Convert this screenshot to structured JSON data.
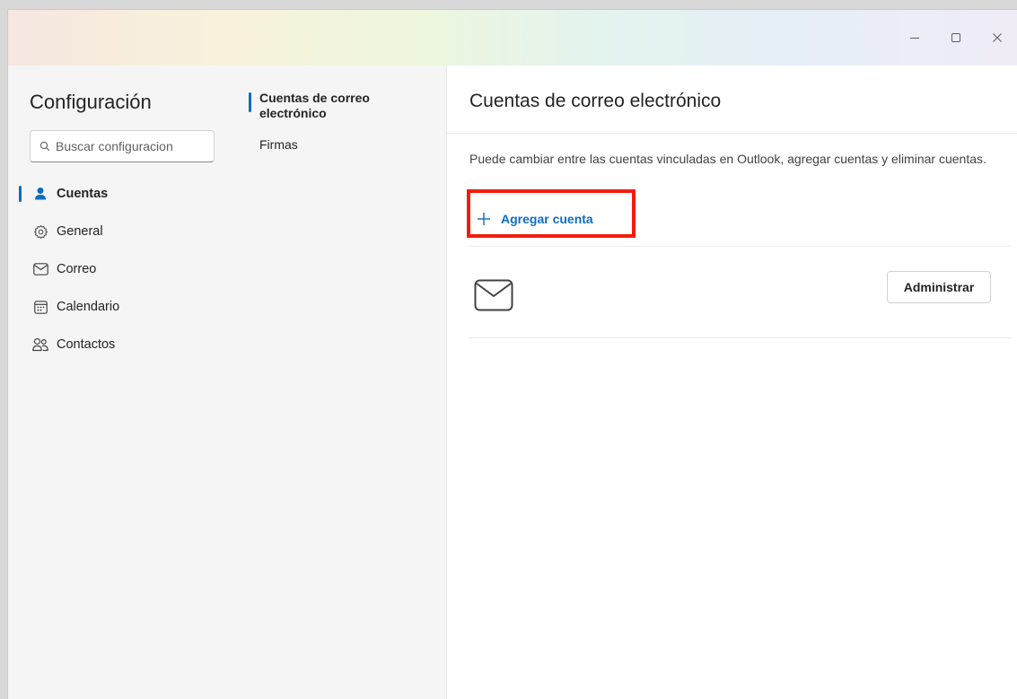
{
  "sidebar": {
    "title": "Configuración",
    "search_placeholder": "Buscar configuracion",
    "items": [
      {
        "label": "Cuentas",
        "icon": "person-icon",
        "active": true
      },
      {
        "label": "General",
        "icon": "gear-icon"
      },
      {
        "label": "Correo",
        "icon": "mail-icon"
      },
      {
        "label": "Calendario",
        "icon": "calendar-icon"
      },
      {
        "label": "Contactos",
        "icon": "people-icon"
      }
    ]
  },
  "subnav": {
    "items": [
      {
        "label": "Cuentas de correo electrónico",
        "active": true
      },
      {
        "label": "Firmas"
      }
    ]
  },
  "main": {
    "title": "Cuentas de correo electrónico",
    "description": "Puede cambiar entre las cuentas vinculadas en Outlook, agregar cuentas y eliminar cuentas.",
    "add_account_label": "Agregar cuenta",
    "manage_label": "Administrar"
  },
  "colors": {
    "accent": "#0f6cbd",
    "highlight": "#f21c0d"
  }
}
